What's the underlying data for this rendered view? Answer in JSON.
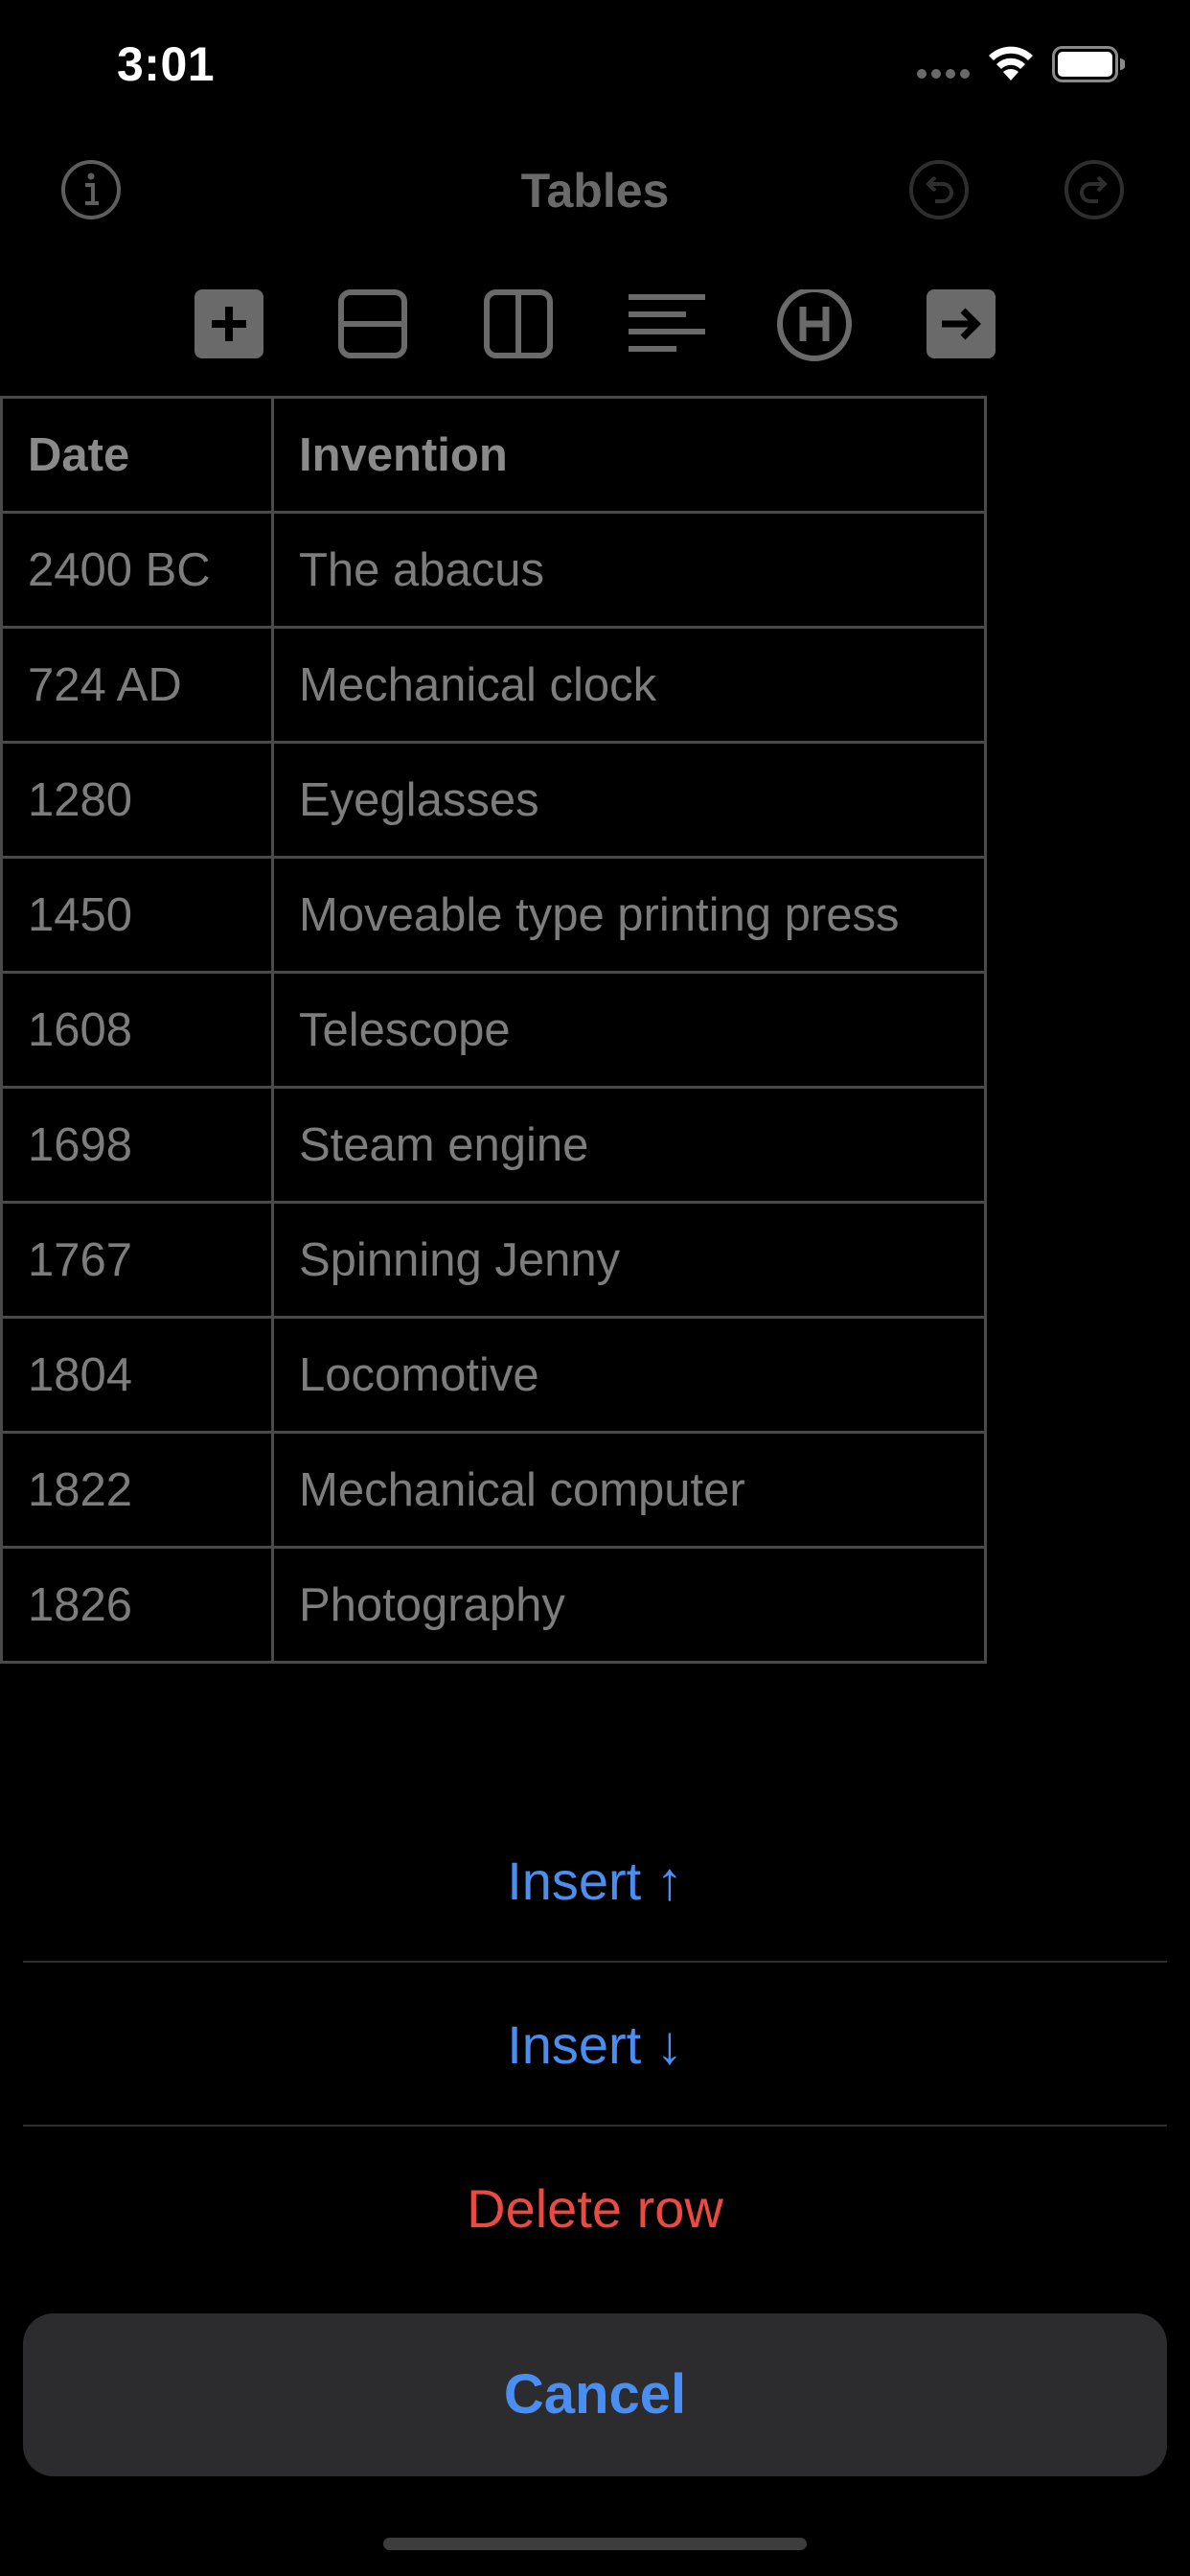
{
  "status_bar": {
    "time": "3:01"
  },
  "nav": {
    "title": "Tables"
  },
  "table": {
    "headers": [
      "Date",
      "Invention"
    ],
    "rows": [
      [
        "2400 BC",
        "The abacus"
      ],
      [
        "724 AD",
        "Mechanical clock"
      ],
      [
        "1280",
        "Eyeglasses"
      ],
      [
        "1450",
        "Moveable type printing press"
      ],
      [
        "1608",
        "Telescope"
      ],
      [
        "1698",
        "Steam engine"
      ],
      [
        "1767",
        "Spinning Jenny"
      ],
      [
        "1804",
        "Locomotive"
      ],
      [
        "1822",
        "Mechanical computer"
      ],
      [
        "1826",
        "Photography"
      ]
    ]
  },
  "action_sheet": {
    "insert_above": "Insert ↑",
    "insert_below": "Insert ↓",
    "delete_row": "Delete row",
    "cancel": "Cancel"
  },
  "colors": {
    "accent": "#4b8ef2",
    "destructive": "#eb4a42",
    "sheet_bg": "#2c2c2e"
  }
}
